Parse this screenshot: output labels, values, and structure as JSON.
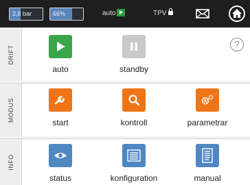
{
  "topbar": {
    "pressure": "2,8 bar",
    "level": "66%",
    "level_fraction": 0.66,
    "mode": "auto",
    "tpv": "TPV",
    "icons": {
      "mode": "play-icon",
      "tpv": "lock-icon",
      "mail": "mail-icon",
      "home": "home-icon"
    }
  },
  "sections": {
    "drift": {
      "label": "DRIFT",
      "items": [
        {
          "label": "auto",
          "icon": "play-icon",
          "color": "#3aa64a"
        },
        {
          "label": "standby",
          "icon": "pause-icon",
          "color": "#c9c9c9"
        }
      ],
      "help": "?"
    },
    "modus": {
      "label": "MODUS",
      "items": [
        {
          "label": "start",
          "icon": "wrench-icon",
          "color": "#ee7417"
        },
        {
          "label": "kontroll",
          "icon": "search-icon",
          "color": "#ee7417"
        },
        {
          "label": "parametrar",
          "icon": "gears-icon",
          "color": "#ee7417"
        }
      ]
    },
    "info": {
      "label": "INFO",
      "items": [
        {
          "label": "status",
          "icon": "eye-icon",
          "color": "#4f87c2"
        },
        {
          "label": "konfiguration",
          "icon": "list-icon",
          "color": "#4f87c2"
        },
        {
          "label": "manual",
          "icon": "document-icon",
          "color": "#4f87c2"
        }
      ]
    }
  }
}
